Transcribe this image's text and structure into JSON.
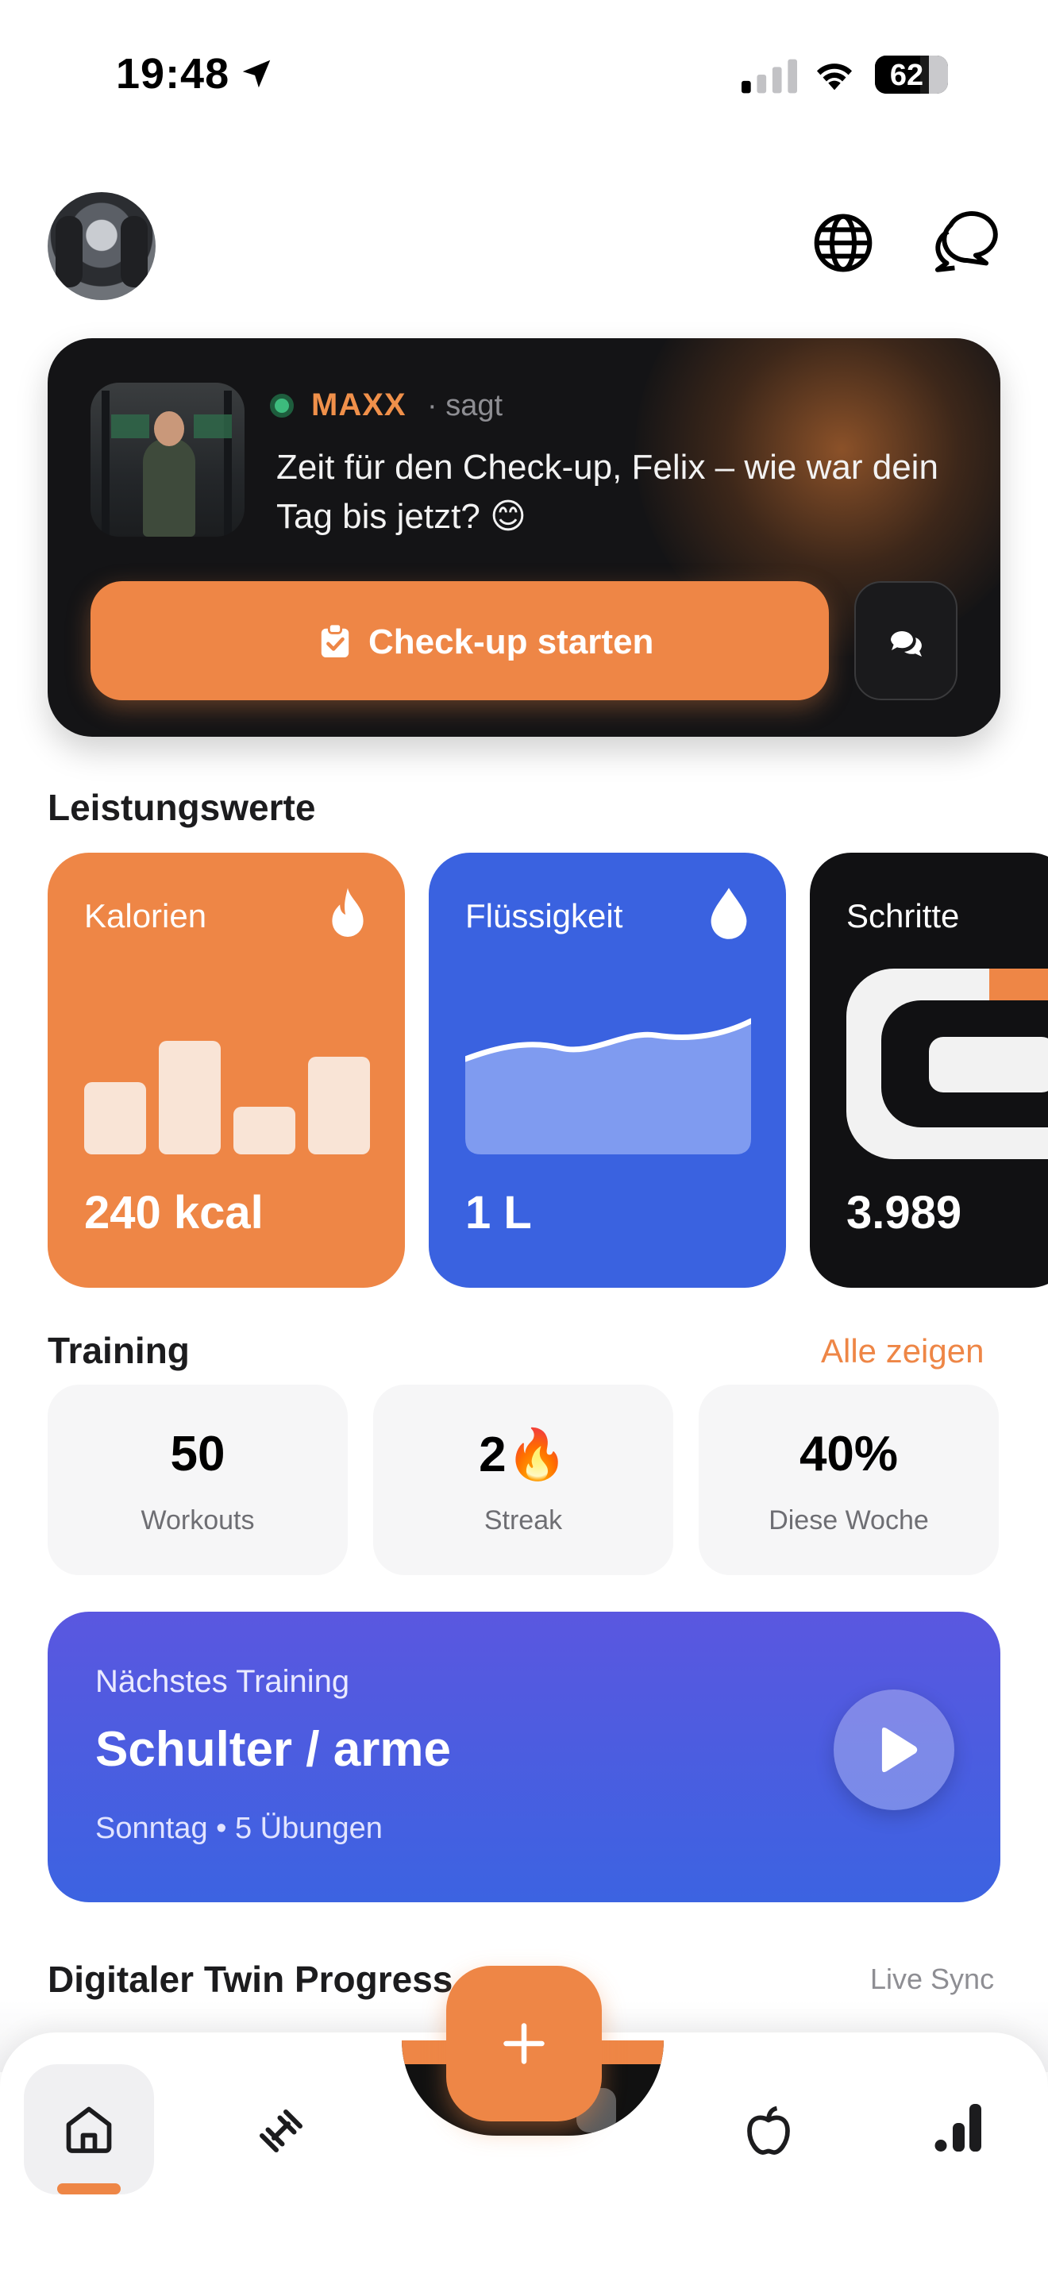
{
  "status_bar": {
    "time": "19:48",
    "battery": "62",
    "battery_level": 0.62
  },
  "header": {
    "avatar_icon": "user-avatar",
    "language_icon": "globe-icon",
    "messages_icon": "chat-bubbles-icon"
  },
  "coach": {
    "name": "MAXX",
    "says": "· sagt",
    "message": "Zeit für den Check-up, Felix – wie war dein Tag bis jetzt? 😊",
    "cta_label": "Check-up starten",
    "status_color": "#3dbb7d"
  },
  "performance": {
    "title": "Leistungswerte",
    "cards": [
      {
        "label": "Kalorien",
        "value": "240 kcal",
        "icon": "flame-icon",
        "color": "#ee8646",
        "bars": [
          0.55,
          0.86,
          0.36,
          0.74
        ]
      },
      {
        "label": "Flüssigkeit",
        "value": "1 L",
        "icon": "water-drop-icon",
        "color": "#3a62e0"
      },
      {
        "label": "Schritte",
        "value": "3.989",
        "color": "#111113"
      }
    ]
  },
  "training": {
    "title": "Training",
    "show_all": "Alle zeigen",
    "stats": [
      {
        "value": "50",
        "label": "Workouts"
      },
      {
        "value": "2🔥",
        "label": "Streak"
      },
      {
        "value": "40%",
        "label": "Diese Woche"
      }
    ]
  },
  "next_training": {
    "overline": "Nächstes Training",
    "title": "Schulter / arme",
    "subtitle": "Sonntag • 5 Übungen"
  },
  "digital_twin": {
    "title": "Digitaler Twin Progress",
    "live_label": "Live Sync"
  },
  "tabs": [
    {
      "name": "home",
      "icon": "home-icon",
      "active": true
    },
    {
      "name": "workouts",
      "icon": "dumbbell-icon",
      "active": false
    },
    {
      "name": "add",
      "icon": "plus-icon",
      "active": false
    },
    {
      "name": "nutrition",
      "icon": "apple-icon",
      "active": false
    },
    {
      "name": "stats",
      "icon": "bar-chart-icon",
      "active": false
    }
  ],
  "colors": {
    "accent": "#ee8646",
    "blue": "#3a62e0",
    "dark": "#141416"
  }
}
